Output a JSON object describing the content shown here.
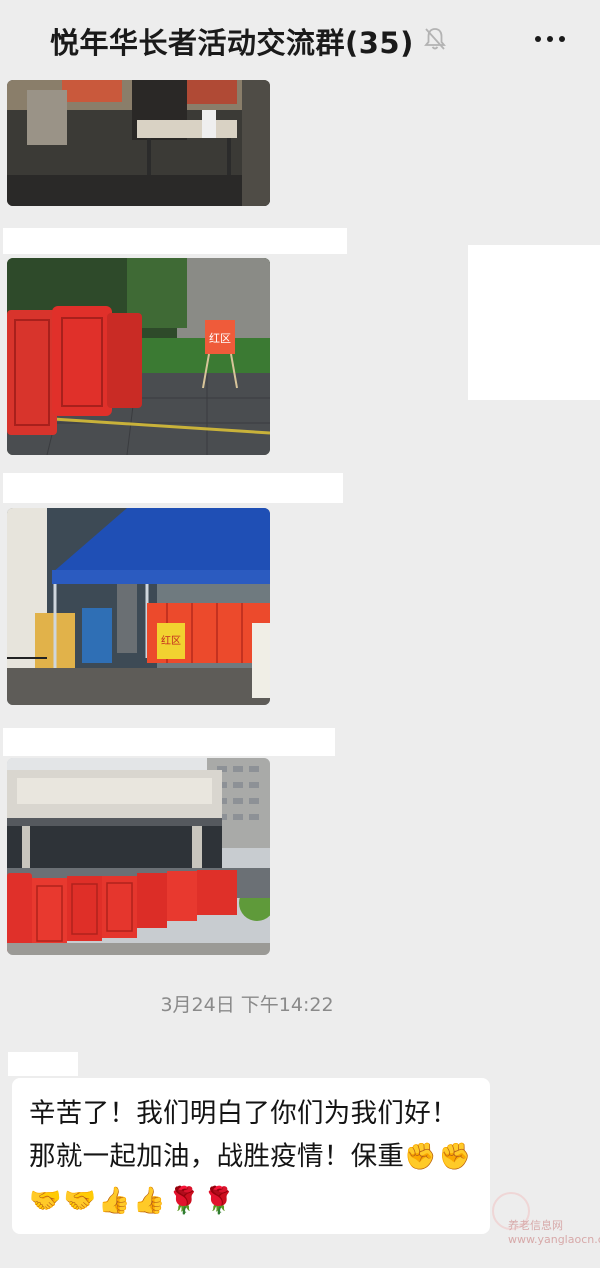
{
  "header": {
    "title": "悦年华长者活动交流群(35)",
    "mute_icon": "bell-off-icon",
    "more_icon": "more-dots-icon",
    "more_label": "···"
  },
  "messages": {
    "photos": [
      {
        "name": "photo-table-area",
        "sign_text": ""
      },
      {
        "name": "photo-red-zone-barriers",
        "sign_text": "红区"
      },
      {
        "name": "photo-blue-tent-entrance",
        "sign_text": "红区"
      },
      {
        "name": "photo-building-red-barriers",
        "sign_text": ""
      }
    ],
    "timestamp": "3月24日 下午14:22",
    "text_message": "辛苦了！我们明白了你们为我们好！那就一起加油，战胜疫情！保重",
    "emojis": [
      "✊",
      "✊",
      "🤝",
      "🤝",
      "👍",
      "👍",
      "🌹",
      "🌹"
    ]
  },
  "watermark": {
    "line1": "养老信息网",
    "line2": "www.yanglaocn.com"
  },
  "colors": {
    "background": "#ededed",
    "bubble": "#ffffff",
    "barrier_red": "#e0302a",
    "tent_blue": "#1f4fb5"
  }
}
